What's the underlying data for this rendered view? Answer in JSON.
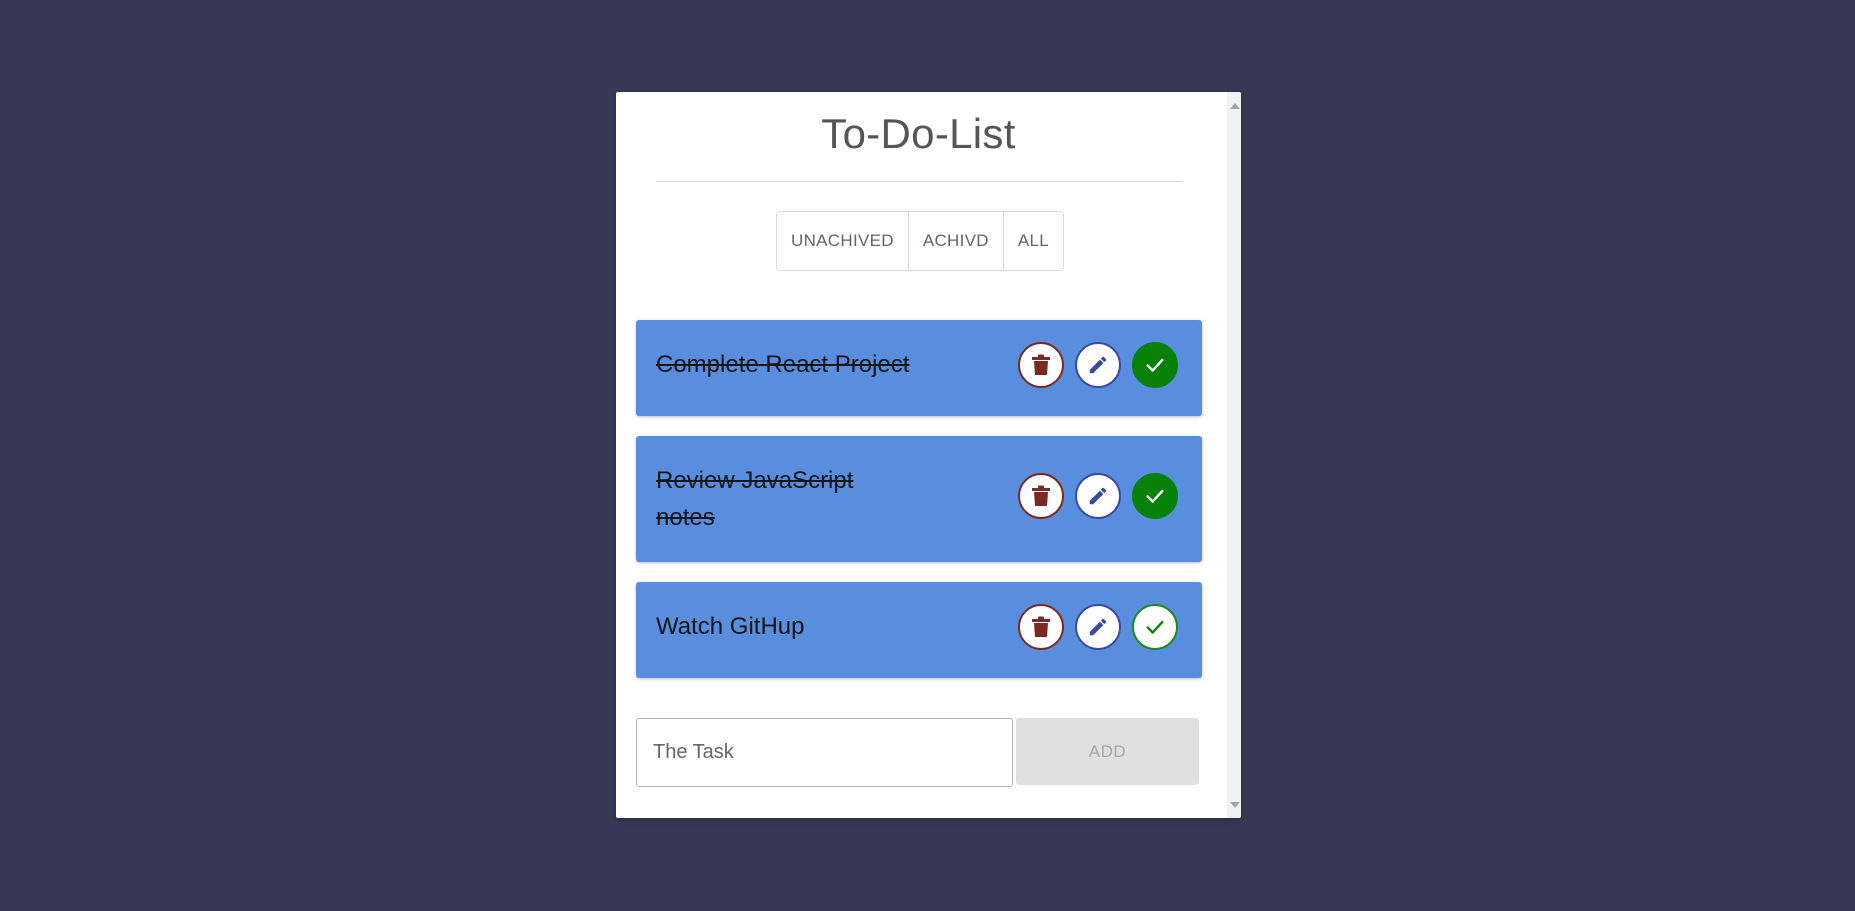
{
  "app": {
    "title": "To-Do-List"
  },
  "filters": [
    {
      "label": "UNACHIVED"
    },
    {
      "label": "ACHIVD"
    },
    {
      "label": "ALL"
    }
  ],
  "tasks": [
    {
      "text": "Complete React Project",
      "done": true
    },
    {
      "text": "Review JavaScript notes",
      "done": true
    },
    {
      "text": "Watch GitHup",
      "done": false
    }
  ],
  "add_form": {
    "placeholder": "The Task",
    "button_label": "ADD"
  },
  "colors": {
    "background": "#383854",
    "task_bg": "#588edd",
    "delete": "#7a2a22",
    "edit": "#3b4aa0",
    "check": "#078107"
  },
  "icons": {
    "delete": "trash-icon",
    "edit": "pencil-icon",
    "check": "check-icon"
  }
}
